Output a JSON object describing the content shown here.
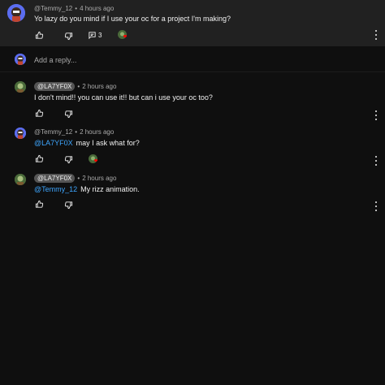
{
  "top_comment": {
    "author": "@Temmy_12",
    "time": "4 hours ago",
    "text": "Yo lazy do you mind if I use your oc for a project I'm making?",
    "reply_count": "3"
  },
  "reply_box": {
    "placeholder": "Add a reply..."
  },
  "replies": [
    {
      "author": "@LA7YF0X",
      "is_creator": true,
      "time": "2 hours ago",
      "mention": "",
      "text": "I don't mind!! you can use it!! but can i use your oc too?"
    },
    {
      "author": "@Temmy_12",
      "is_creator": false,
      "time": "2 hours ago",
      "mention": "@LA7YF0X",
      "text": "may I ask what for?"
    },
    {
      "author": "@LA7YF0X",
      "is_creator": true,
      "time": "2 hours ago",
      "mention": "@Temmy_12",
      "text": "My rizz animation."
    }
  ],
  "separator": "•",
  "colors": {
    "background": "#0f0f0f",
    "top_comment_bg": "#212121",
    "mention": "#3ea6ff",
    "creator_chip": "#555555",
    "heart": "#ff0000"
  },
  "icons": [
    "thumbs-up-icon",
    "thumbs-down-icon",
    "reply-icon",
    "more-vert-icon",
    "creator-heart-icon"
  ]
}
